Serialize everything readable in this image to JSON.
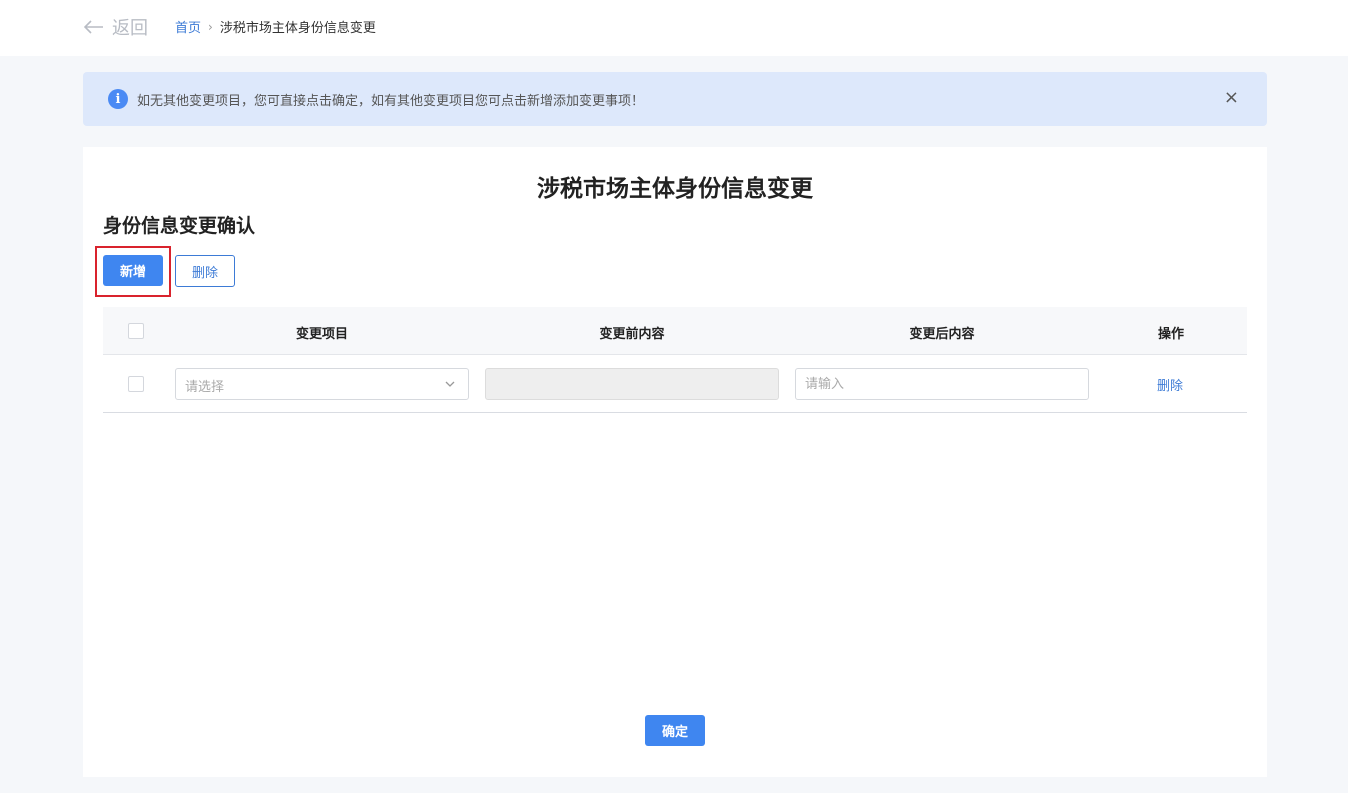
{
  "header": {
    "back_label": "返回",
    "breadcrumb": {
      "home": "首页",
      "separator": "›",
      "current": "涉税市场主体身份信息变更"
    }
  },
  "notice": {
    "icon": "info-icon",
    "message": "如无其他变更项目，您可直接点击确定，如有其他变更项目您可点击新增添加变更事项！",
    "close_label": "×"
  },
  "page": {
    "title": "涉税市场主体身份信息变更",
    "section_title": "身份信息变更确认"
  },
  "toolbar": {
    "add_label": "新增",
    "delete_label": "删除"
  },
  "table": {
    "columns": [
      "变更项目",
      "变更前内容",
      "变更后内容",
      "操作"
    ],
    "rows": [
      {
        "item_placeholder": "请选择",
        "before_value": "",
        "after_placeholder": "请输入",
        "action_label": "删除"
      }
    ]
  },
  "footer": {
    "confirm_label": "确定"
  },
  "colors": {
    "primary": "#3f86f0",
    "link": "#3d7bd6",
    "notice_bg": "#dde8fb",
    "highlight_border": "#d9232d"
  }
}
